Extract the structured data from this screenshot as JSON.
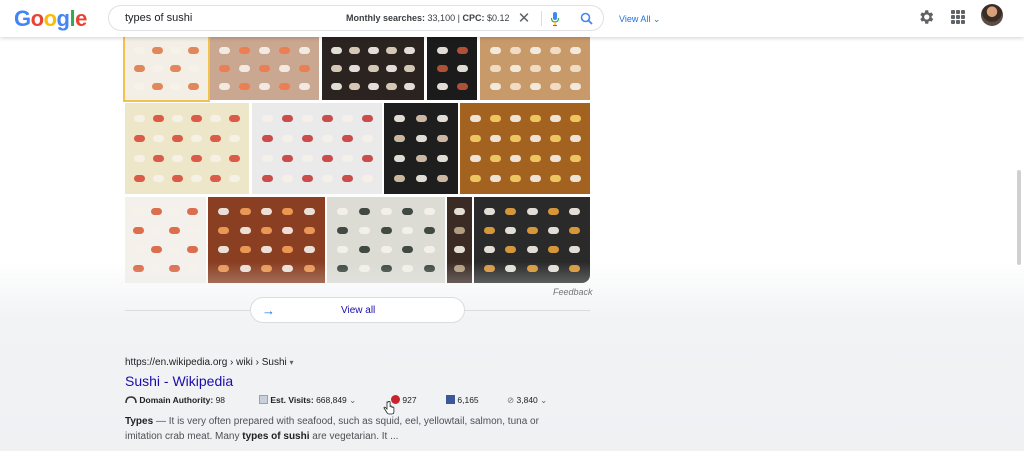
{
  "header": {
    "logo_letters": [
      {
        "ch": "G",
        "color": "#4285F4"
      },
      {
        "ch": "o",
        "color": "#EA4335"
      },
      {
        "ch": "o",
        "color": "#FBBC05"
      },
      {
        "ch": "g",
        "color": "#4285F4"
      },
      {
        "ch": "l",
        "color": "#34A853"
      },
      {
        "ch": "e",
        "color": "#EA4335"
      }
    ],
    "query": "types of sushi",
    "metrics": {
      "searches_label": "Monthly searches:",
      "searches_value": "33,100",
      "divider": "|",
      "cpc_label": "CPC:",
      "cpc_value": "$0.12"
    },
    "clear_glyph": "✕",
    "view_all": "View All",
    "view_all_caret": "⌄",
    "icons": [
      "close-icon",
      "microphone-icon",
      "search-icon",
      "gear-icon",
      "apps-grid-icon",
      "avatar"
    ]
  },
  "images": {
    "feedback": "Feedback",
    "view_all_label": "View all",
    "arrow": "→",
    "tiles": [
      {
        "name": "sushi-chart-white-card",
        "bg": "#f3efe6",
        "accent": "#e07b4a"
      },
      {
        "name": "salmon-nigiri-plate",
        "bg": "#c9a790",
        "accent": "#f07a4e"
      },
      {
        "name": "sushi-menu-dark",
        "bg": "#2b2320",
        "accent": "#e8d9c7"
      },
      {
        "name": "sushi-grid-black",
        "bg": "#1b1b1b",
        "accent": "#c0573c"
      },
      {
        "name": "sushi-on-wood",
        "bg": "#c89a6a",
        "accent": "#f4e2cf"
      },
      {
        "name": "sushi-poster-pastel",
        "bg": "#eee6c8",
        "accent": "#d74d3a"
      },
      {
        "name": "sushi-101-white",
        "bg": "#eaeaea",
        "accent": "#c93a3a"
      },
      {
        "name": "sushi-types-black-chart",
        "bg": "#1e1e1e",
        "accent": "#dfc9b0"
      },
      {
        "name": "types-of-sushi-poster",
        "bg": "#a3621f",
        "accent": "#f5d267"
      },
      {
        "name": "sushi-illustration-white",
        "bg": "#f4f1ec",
        "accent": "#d85f3b"
      },
      {
        "name": "sushi-rolls-closeup",
        "bg": "#8a3f22",
        "accent": "#f4a15b"
      },
      {
        "name": "sushi-spread-white",
        "bg": "#dcdcd5",
        "accent": "#2f3a33"
      },
      {
        "name": "sushi-narrow-strip",
        "bg": "#3a2b25",
        "accent": "#c2a88a"
      },
      {
        "name": "temari-sushi-dark",
        "bg": "#2a2a2a",
        "accent": "#e9a33c"
      }
    ]
  },
  "result": {
    "cite": "https://en.wikipedia.org › wiki › Sushi",
    "cite_caret": "▾",
    "title": "Sushi - Wikipedia",
    "moz": {
      "da_label": "Domain Authority:",
      "da_value": "98",
      "visits_label": "Est. Visits:",
      "visits_value": "668,849",
      "pinterest_value": "927",
      "facebook_value": "6,165",
      "links_value": "3,840",
      "caret": "⌄"
    },
    "snippet": {
      "b1": "Types",
      "t1": " — It is very often prepared with seafood, such as squid, eel, yellowtail, salmon, tuna or imitation crab meat. Many ",
      "b2": "types of sushi",
      "t2": " are vegetarian. It ..."
    }
  }
}
